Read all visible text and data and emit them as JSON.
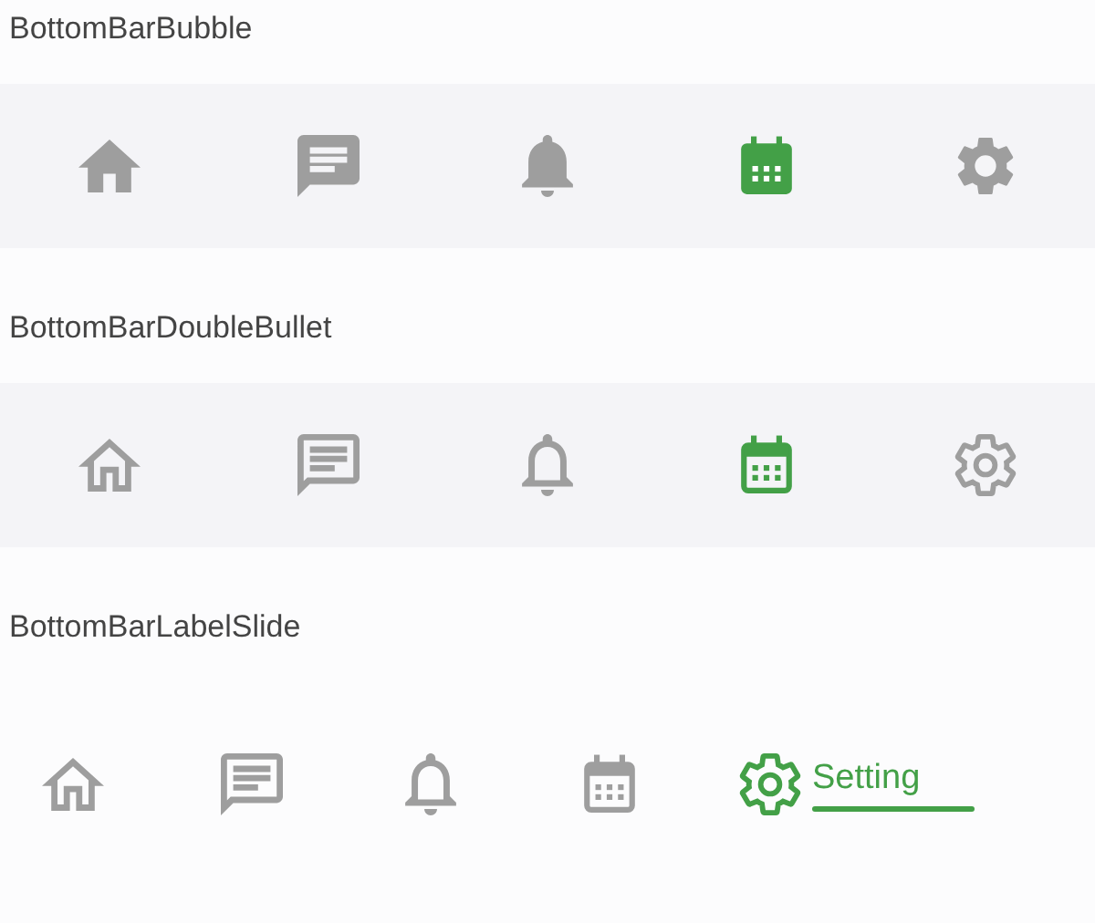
{
  "sections": [
    {
      "title": "BottomBarBubble",
      "kind": "bubble",
      "items": [
        {
          "selected": false
        },
        {
          "selected": false
        },
        {
          "selected": false
        },
        {
          "selected": true
        },
        {
          "selected": false
        }
      ]
    },
    {
      "title": "BottomBarDoubleBullet",
      "kind": "double-bullet",
      "items": [
        {
          "selected": false
        },
        {
          "selected": false
        },
        {
          "selected": false
        },
        {
          "selected": true
        },
        {
          "selected": false
        }
      ]
    },
    {
      "title": "BottomBarLabelSlide",
      "kind": "label-slide",
      "items": [
        {
          "selected": false
        },
        {
          "selected": false
        },
        {
          "selected": false
        },
        {
          "selected": false
        },
        {
          "selected": true,
          "label": "Setting"
        }
      ]
    }
  ]
}
